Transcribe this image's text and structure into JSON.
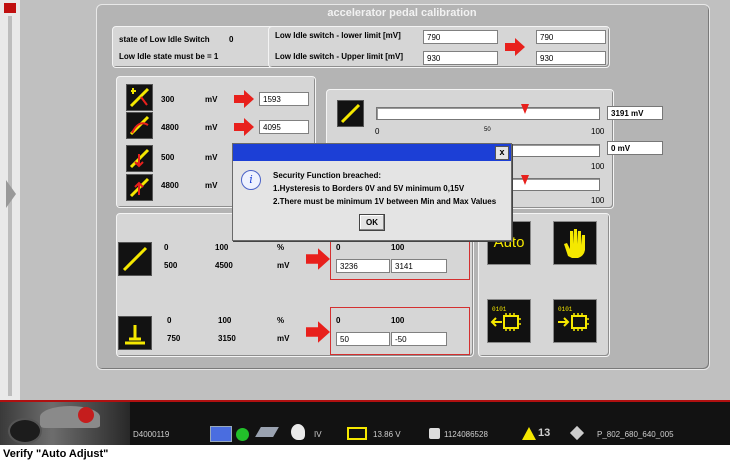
{
  "window": {
    "title": "accelerator pedal calibration"
  },
  "idle_switch": {
    "state_label": "state of Low Idle Switch",
    "state_value": "0",
    "must_be_label": "Low Idle state must be = 1",
    "lower_label": "Low Idle switch - lower limit [mV]",
    "upper_label": "Low Idle switch - Upper limit [mV]",
    "lower_value": "790",
    "upper_value": "930",
    "lower_target": "790",
    "upper_target": "930"
  },
  "sensor_rows": [
    {
      "value": "300",
      "unit": "mV",
      "field": "1593"
    },
    {
      "value": "4800",
      "unit": "mV",
      "field": "4095"
    },
    {
      "value": "500",
      "unit": "mV"
    },
    {
      "value": "4800",
      "unit": "mV"
    }
  ],
  "sliders": [
    {
      "min_label": "0",
      "mid_label": "50",
      "max_label": "100",
      "readout": "3191 mV",
      "marker_fraction": 0.7
    },
    {
      "max_label": "100",
      "readout": "0 mV",
      "marker_fraction": 0.0
    },
    {
      "max_label": "100",
      "marker_fraction": 0.7
    }
  ],
  "calib": {
    "pedal": {
      "pct_min": "0",
      "pct_max": "100",
      "pct_unit": "%",
      "mv_min": "500",
      "mv_max": "4500",
      "mv_unit": "mV",
      "out_label_min": "0",
      "out_label_max": "100",
      "out_min": "3236",
      "out_max": "3141"
    },
    "idle": {
      "pct_min": "0",
      "pct_max": "100",
      "pct_unit": "%",
      "mv_min": "750",
      "mv_max": "3150",
      "mv_unit": "mV",
      "out_label_min": "0",
      "out_label_max": "100",
      "out_min": "50",
      "out_max": "-50"
    }
  },
  "buttons": {
    "auto": "Auto"
  },
  "dialog": {
    "title": "Security Function breached:",
    "line1": "1.Hysteresis to Borders 0V and 5V minimum 0,15V",
    "line2": "2.There must be minimum 1V between Min and Max Values",
    "ok": "OK",
    "close": "x"
  },
  "statusbar": {
    "id": "D4000119",
    "mode": "IV",
    "voltage": "13.86 V",
    "counter": "1124086528",
    "warnings": "13",
    "code": "P_802_680_640_005"
  },
  "caption": "Verify \"Auto Adjust\"",
  "colors": {
    "accent_red": "#e8201c",
    "titlebar_blue": "#1c3fd6",
    "icon_yellow": "#f5e800",
    "panel_gray": "#d6d6d6"
  }
}
